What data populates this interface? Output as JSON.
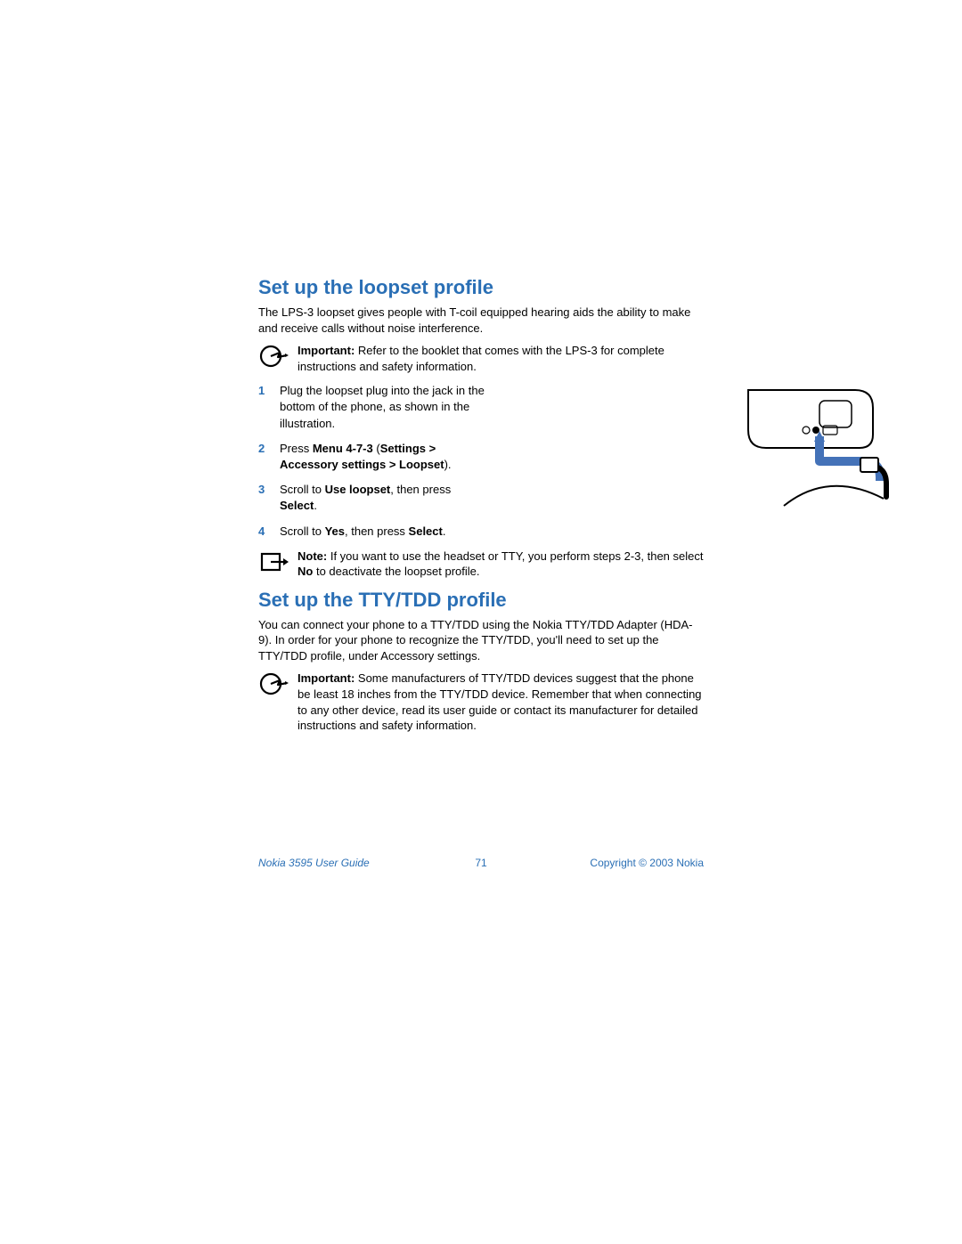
{
  "section1": {
    "heading": "Set up the loopset profile",
    "intro": "The LPS-3 loopset gives people with T-coil equipped hearing aids the ability to make and receive calls without noise interference.",
    "important_label": "Important:",
    "important_text": " Refer to the booklet that comes with the LPS-3 for complete instructions and safety information.",
    "steps": [
      {
        "n": "1",
        "text": "Plug the loopset plug into the jack in the bottom of the phone, as shown in the illustration."
      },
      {
        "n": "2",
        "pre": "Press ",
        "b1": "Menu 4-7-3",
        "mid": " (",
        "b2": "Settings > Accessory settings > Loopset",
        "post": ")."
      },
      {
        "n": "3",
        "pre": "Scroll to ",
        "b1": "Use loopset",
        "mid": ", then press ",
        "b2": "Select",
        "post": "."
      },
      {
        "n": "4",
        "pre": "Scroll to ",
        "b1": "Yes",
        "mid": ", then press ",
        "b2": "Select",
        "post": "."
      }
    ],
    "note_label": "Note:",
    "note_pre": " If you want to use the headset or TTY, you perform steps 2-3, then select ",
    "note_b": "No",
    "note_post": " to deactivate the loopset profile."
  },
  "section2": {
    "heading": "Set up the TTY/TDD profile",
    "intro": "You can connect your phone to a TTY/TDD using the Nokia TTY/TDD Adapter (HDA-9). In order for your phone to recognize the TTY/TDD, you'll need to set up the TTY/TDD profile, under Accessory settings.",
    "important_label": "Important:",
    "important_text": " Some manufacturers of TTY/TDD devices suggest that the phone be least 18 inches from the TTY/TDD device. Remember that when connecting to any other device, read its user guide or contact its manufacturer for detailed instructions and safety information."
  },
  "footer": {
    "left": "Nokia 3595 User Guide",
    "center": "71",
    "right": "Copyright © 2003 Nokia"
  }
}
